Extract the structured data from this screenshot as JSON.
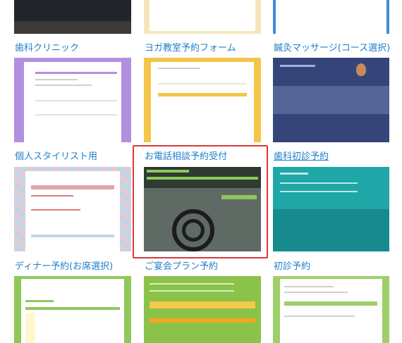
{
  "cards": [
    {
      "id": "dental-clinic",
      "title": "歯科クリニック",
      "underlined": false,
      "theme": "#b38fe0"
    },
    {
      "id": "yoga",
      "title": "ヨガ教室予約フォーム",
      "underlined": false,
      "theme": "#f3c64a"
    },
    {
      "id": "acupuncture",
      "title": "鍼灸マッサージ(コース選択)",
      "underlined": false,
      "theme": "#35457a"
    },
    {
      "id": "stylist",
      "title": "個人スタイリスト用",
      "underlined": false,
      "theme": "#d9b9c4"
    },
    {
      "id": "phone-consult",
      "title": "お電話相談予約受付",
      "underlined": false,
      "theme": "#6f8f6a",
      "selected": true
    },
    {
      "id": "dental-first",
      "title": "歯科初診予約",
      "underlined": true,
      "theme": "#1fa6a6"
    },
    {
      "id": "dinner",
      "title": "ディナー予約(お席選択)",
      "underlined": false,
      "theme": "#8fc85a"
    },
    {
      "id": "party",
      "title": "ご宴会プラン予約",
      "underlined": false,
      "theme": "#8ac24a"
    },
    {
      "id": "first-visit",
      "title": "初診予約",
      "underlined": false,
      "theme": "#9ecf6a"
    }
  ],
  "colors": {
    "link": "#1f7fc9",
    "selection": "#d83a3a",
    "accent_blue": "#3b8fdc"
  }
}
